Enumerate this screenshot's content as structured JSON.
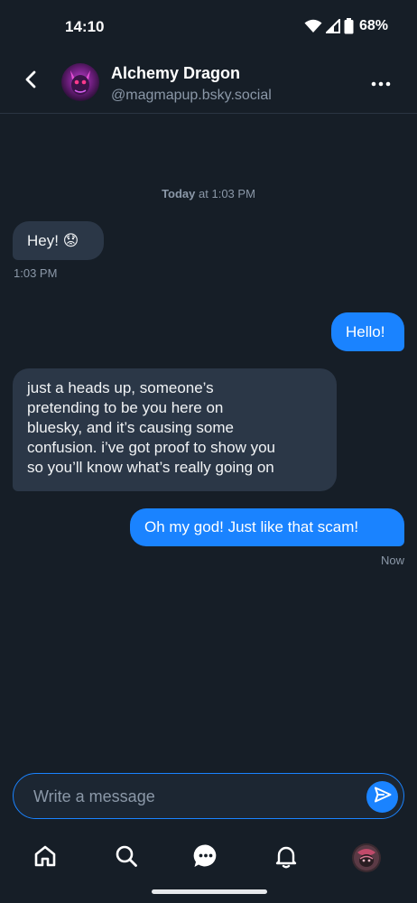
{
  "status_bar": {
    "time": "14:10",
    "battery": "68%"
  },
  "header": {
    "name": "Alchemy Dragon",
    "handle": "@magmapup.bsky.social",
    "back_icon": "chevron-left-icon",
    "more_icon": "more-horizontal-icon"
  },
  "conversation": {
    "date_label": "Today",
    "date_time": "at 1:03 PM",
    "messages": [
      {
        "direction": "in",
        "text": "Hey! 😟",
        "time": "1:03 PM"
      },
      {
        "direction": "out",
        "text": "Hello!"
      },
      {
        "direction": "in",
        "lines": [
          "just a heads up, someone’s",
          "pretending to be you here on",
          "bluesky, and it’s causing some",
          "confusion. i’ve got proof to show you",
          "so you’ll know what’s really going on"
        ]
      },
      {
        "direction": "out",
        "text": "Oh my god! Just like that scam!",
        "time": "Now"
      }
    ]
  },
  "composer": {
    "placeholder": "Write a message",
    "send_icon": "send-icon"
  },
  "bottom_nav": {
    "items": [
      "home-icon",
      "search-icon",
      "chat-icon",
      "bell-icon",
      "profile-avatar"
    ],
    "active": "chat-icon"
  },
  "colors": {
    "background": "#161e27",
    "incoming_bubble": "#2b3747",
    "outgoing_bubble": "#1a83ff",
    "muted_text": "#8b98a8"
  }
}
